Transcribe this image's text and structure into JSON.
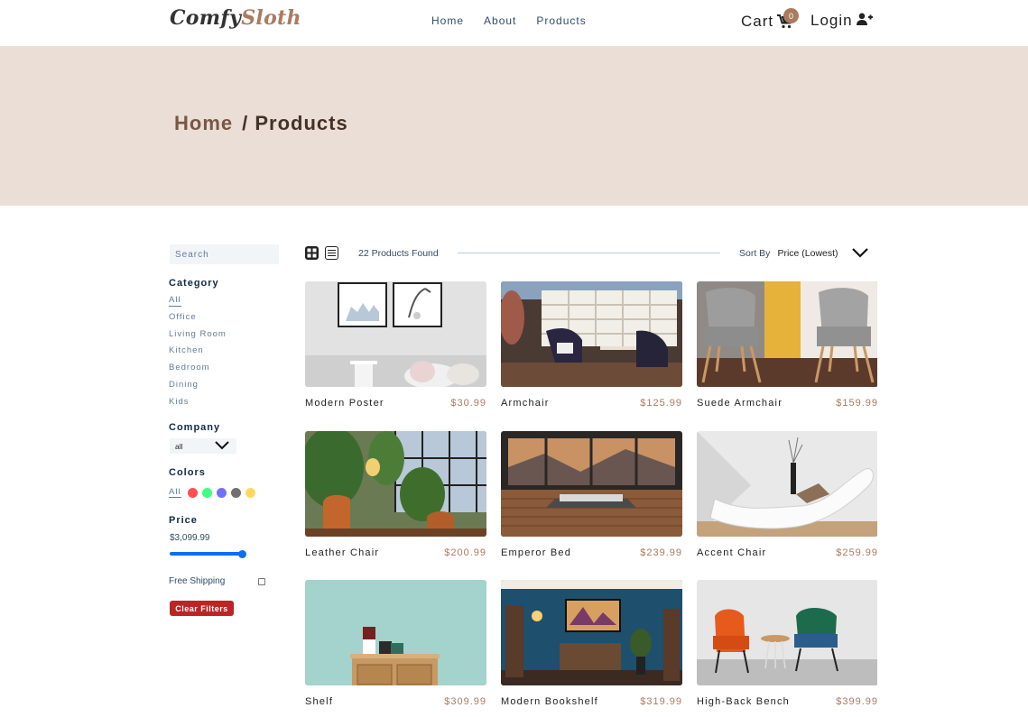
{
  "brand": {
    "part1": "Comfy",
    "part2": "Sloth"
  },
  "nav": {
    "links": [
      "Home",
      "About",
      "Products"
    ]
  },
  "cart": {
    "label": "Cart",
    "count": "0"
  },
  "login": {
    "label": "Login"
  },
  "hero": {
    "home": "Home",
    "current": "/ Products"
  },
  "filters": {
    "search_placeholder": "Search",
    "category_title": "Category",
    "categories": [
      "All",
      "Office",
      "Living Room",
      "Kitchen",
      "Bedroom",
      "Dining",
      "Kids"
    ],
    "company_title": "Company",
    "company_selected": "all",
    "colors_title": "Colors",
    "colors_all": "All",
    "colors": [
      "#ff5050",
      "#40ff80",
      "#7070ff",
      "#707070",
      "#ffd860"
    ],
    "price_title": "Price",
    "price_value": "$3,099.99",
    "price_fraction": 1.0,
    "shipping_label": "Free Shipping",
    "clear_label": "Clear Filters"
  },
  "toolbar": {
    "count_text": "22 Products Found",
    "sort_label": "Sort By",
    "sort_value": "Price (Lowest)"
  },
  "products": [
    {
      "name": "Modern Poster",
      "price": "$30.99"
    },
    {
      "name": "Armchair",
      "price": "$125.99"
    },
    {
      "name": "Suede Armchair",
      "price": "$159.99"
    },
    {
      "name": "Leather Chair",
      "price": "$200.99"
    },
    {
      "name": "Emperor Bed",
      "price": "$239.99"
    },
    {
      "name": "Accent Chair",
      "price": "$259.99"
    },
    {
      "name": "Shelf",
      "price": "$309.99"
    },
    {
      "name": "Modern Bookshelf",
      "price": "$319.99"
    },
    {
      "name": "High-Back Bench",
      "price": "$399.99"
    }
  ]
}
